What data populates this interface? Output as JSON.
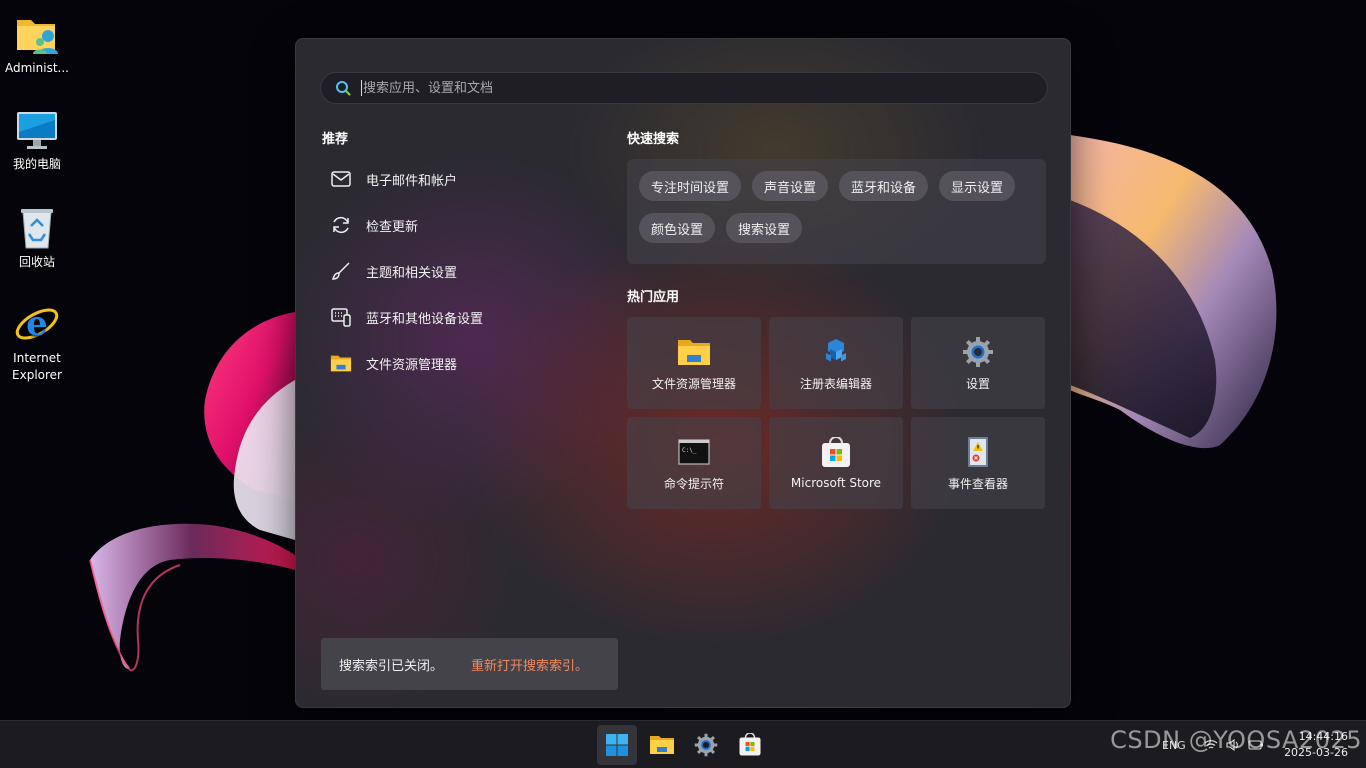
{
  "desktop": {
    "icons": [
      {
        "label": "Administ...",
        "icon": "user-folder-icon"
      },
      {
        "label": "我的电脑",
        "icon": "computer-icon"
      },
      {
        "label": "回收站",
        "icon": "recycle-bin-icon"
      },
      {
        "label": "Internet\nExplorer",
        "icon": "internet-explorer-icon"
      }
    ]
  },
  "search": {
    "placeholder": "搜索应用、设置和文档"
  },
  "recommended": {
    "title": "推荐",
    "items": [
      {
        "label": "电子邮件和帐户",
        "icon": "mail-icon"
      },
      {
        "label": "检查更新",
        "icon": "refresh-icon"
      },
      {
        "label": "主题和相关设置",
        "icon": "brush-icon"
      },
      {
        "label": "蓝牙和其他设备设置",
        "icon": "keyboard-device-icon"
      },
      {
        "label": "文件资源管理器",
        "icon": "folder-icon"
      }
    ]
  },
  "quick_search": {
    "title": "快速搜索",
    "chips": [
      "专注时间设置",
      "声音设置",
      "蓝牙和设备",
      "显示设置",
      "颜色设置",
      "搜索设置"
    ]
  },
  "top_apps": {
    "title": "热门应用",
    "apps": [
      {
        "label": "文件资源管理器",
        "icon": "folder-icon"
      },
      {
        "label": "注册表编辑器",
        "icon": "registry-icon"
      },
      {
        "label": "设置",
        "icon": "settings-gear-icon"
      },
      {
        "label": "命令提示符",
        "icon": "terminal-icon"
      },
      {
        "label": "Microsoft Store",
        "icon": "store-icon"
      },
      {
        "label": "事件查看器",
        "icon": "event-viewer-icon"
      }
    ]
  },
  "index_notice": {
    "message": "搜索索引已关闭。",
    "link": "重新打开搜索索引。"
  },
  "taskbar": {
    "apps": [
      "start-icon",
      "folder-icon",
      "settings-gear-icon",
      "store-icon"
    ],
    "language": "ENG",
    "time": "14:44:16",
    "date": "2025-03-26"
  },
  "watermark": "CSDN @YOOSA2025",
  "colors": {
    "accent_link": "#ef8a62",
    "panel_bg": "#2b2a31",
    "taskbar_bg": "#1c1c20"
  }
}
